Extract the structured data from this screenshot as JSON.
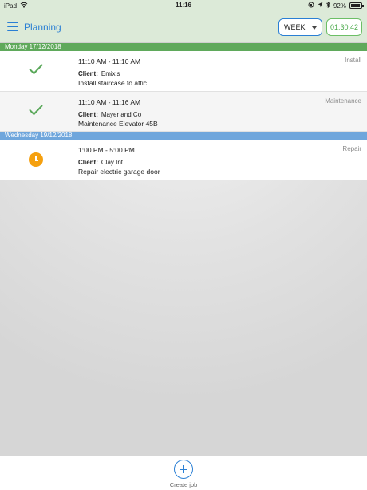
{
  "status_bar": {
    "device": "iPad",
    "time": "11:16",
    "battery": "92%",
    "battery_level": 0.92
  },
  "header": {
    "title": "Planning",
    "view_select": "WEEK",
    "timer": "01:30:42"
  },
  "days": [
    {
      "label": "Monday 17/12/2018",
      "color": "#5fa95b",
      "jobs": [
        {
          "time": "11:10 AM - 11:10 AM",
          "client_label": "Client:",
          "client": "Emixis",
          "description": "Install staircase to attic",
          "type": "Install",
          "status_icon": "check-icon"
        },
        {
          "time": "11:10 AM - 11:16 AM",
          "client_label": "Client:",
          "client": "Mayer and Co",
          "description": "Maintenance Elevator 45B",
          "type": "Maintenance",
          "status_icon": "check-icon"
        }
      ]
    },
    {
      "label": "Wednesday 19/12/2018",
      "color": "#6fa6dc",
      "jobs": [
        {
          "time": "1:00 PM - 5:00 PM",
          "client_label": "Client:",
          "client": "Clay Int",
          "description": "Repair electric garage door",
          "type": "Repair",
          "status_icon": "clock-icon"
        }
      ]
    }
  ],
  "footer": {
    "create_label": "Create job"
  },
  "colors": {
    "accent": "#2a7fd4",
    "header_bg": "#dcead8",
    "done": "#5aa85a",
    "pending": "#f5a00f"
  }
}
